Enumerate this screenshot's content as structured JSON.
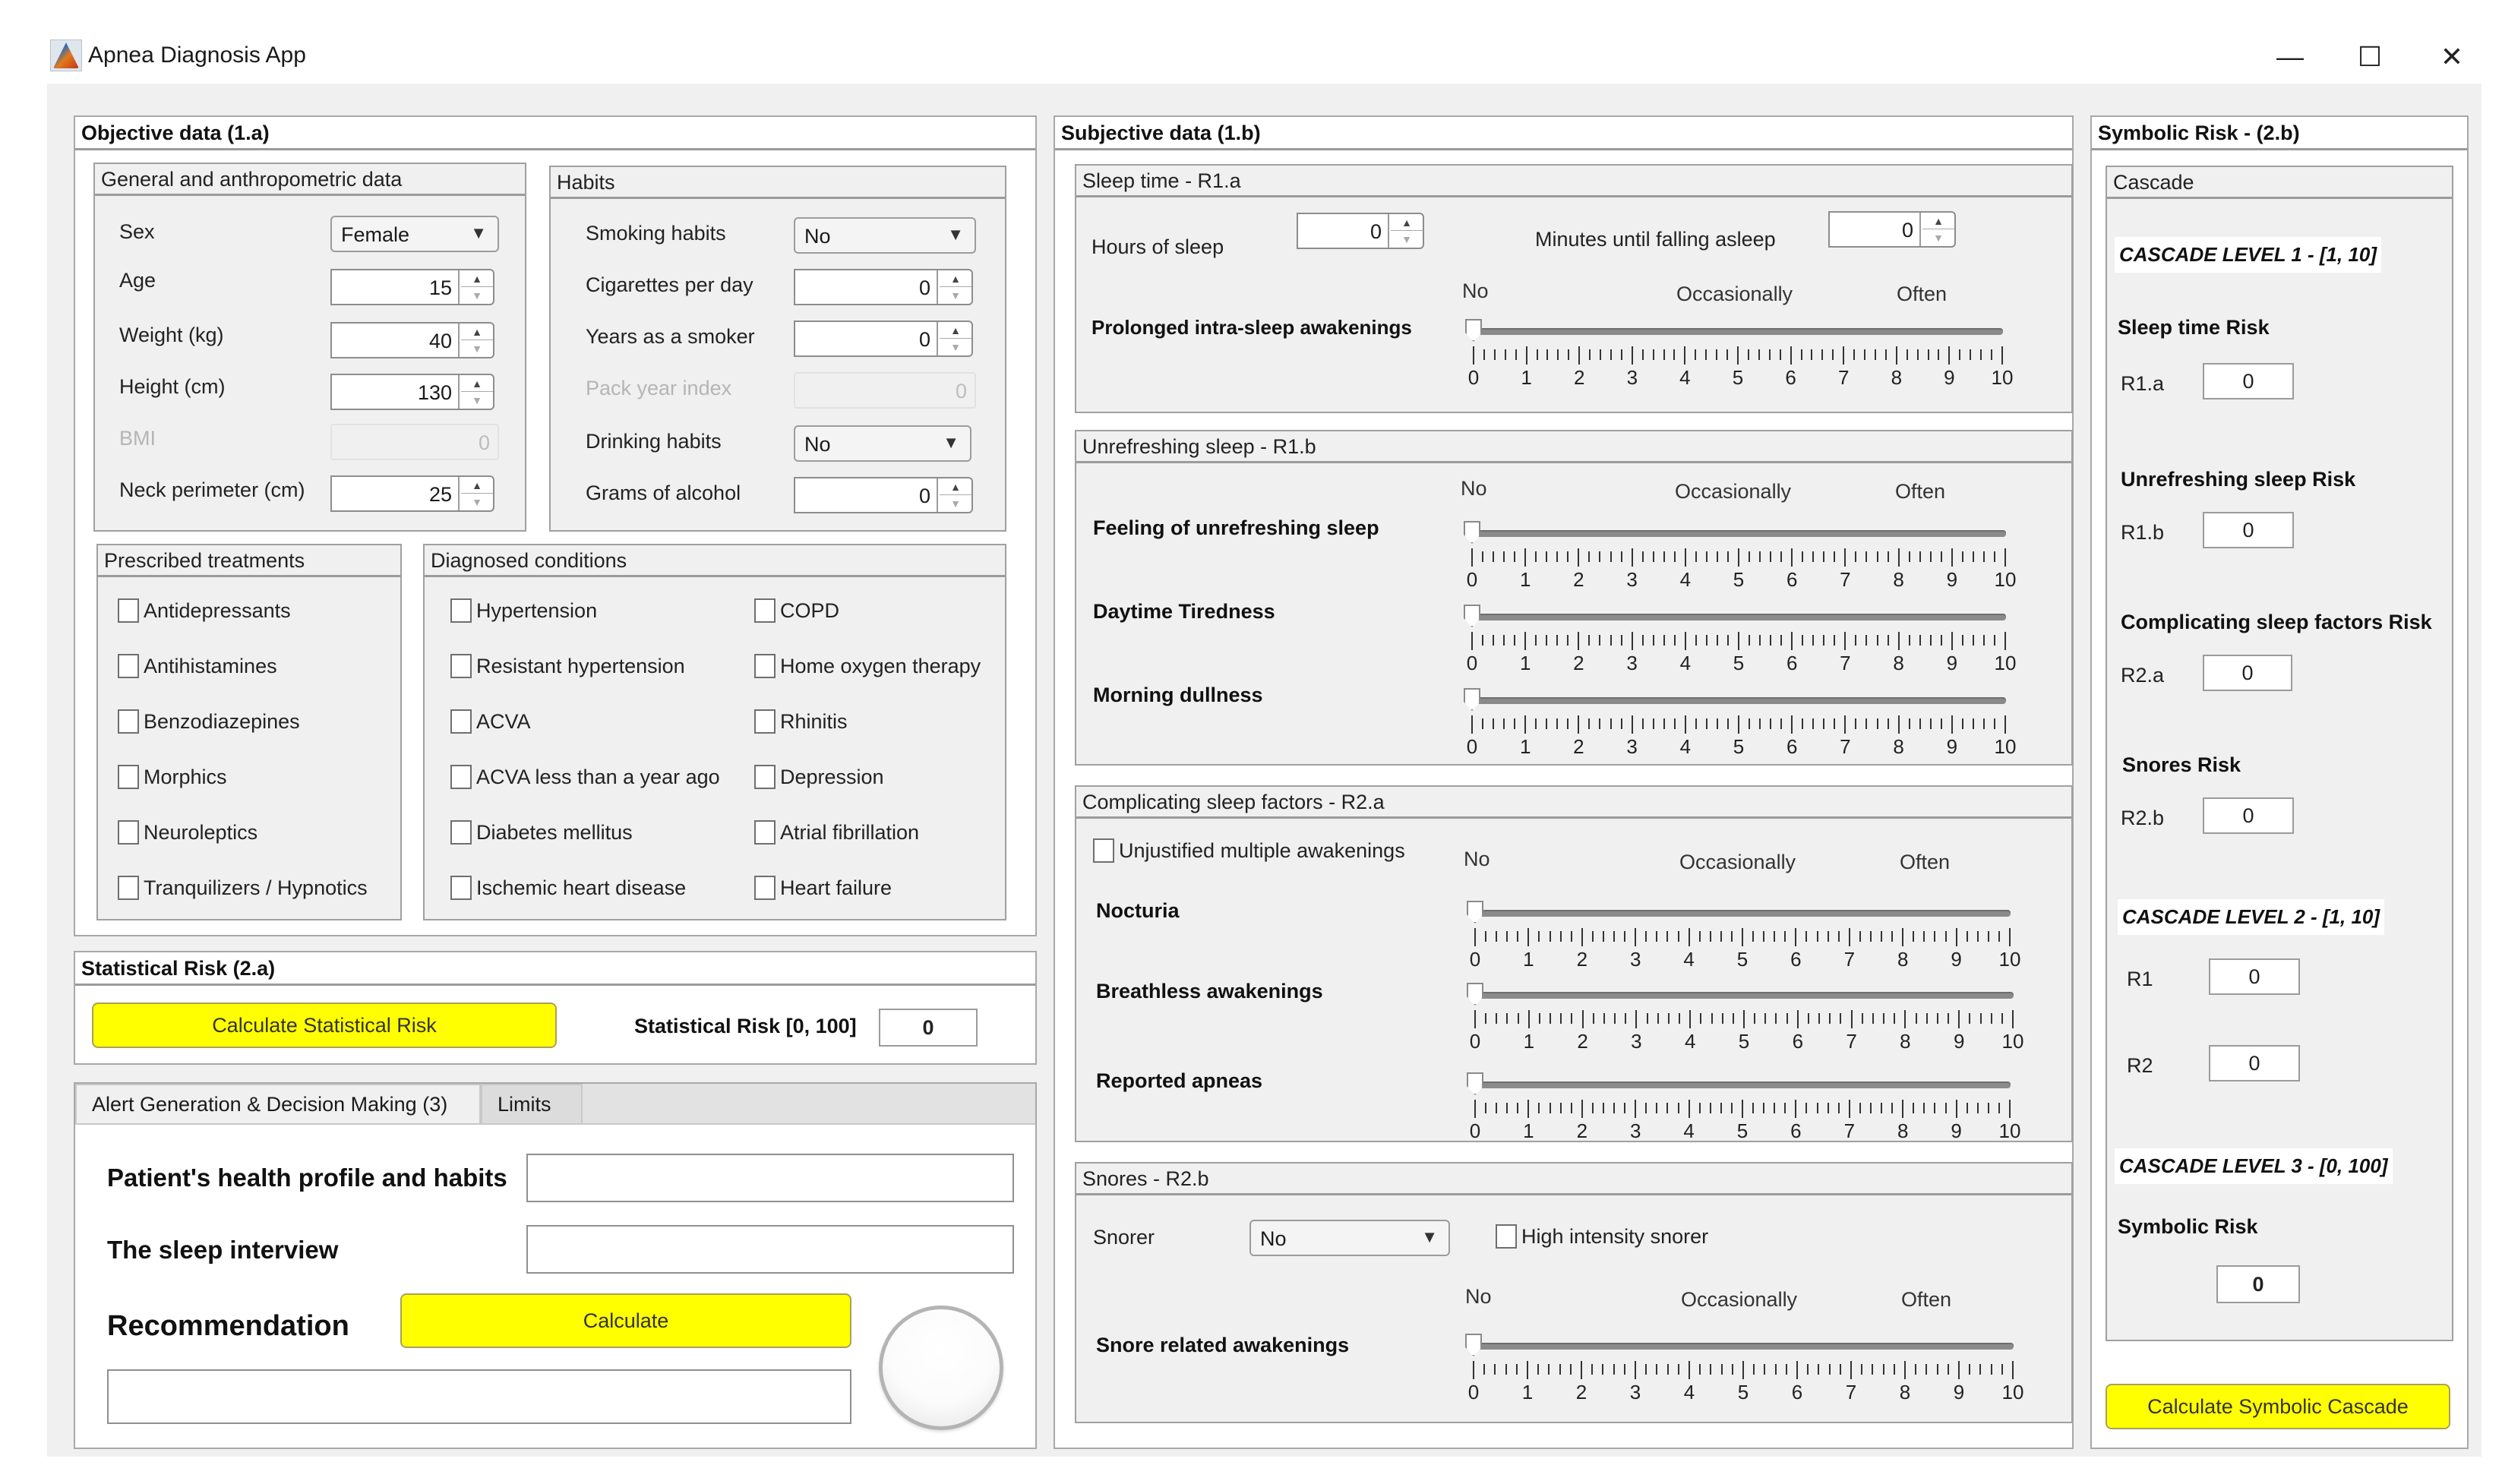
{
  "window": {
    "title": "Apnea Diagnosis App",
    "controls": {
      "minimize": "—",
      "maximize": "☐",
      "close": "✕"
    }
  },
  "objective": {
    "title": "Objective data (1.a)",
    "general": {
      "title": "General and anthropometric data",
      "sex_label": "Sex",
      "sex_value": "Female",
      "age_label": "Age",
      "age_value": "15",
      "weight_label": "Weight (kg)",
      "weight_value": "40",
      "height_label": "Height (cm)",
      "height_value": "130",
      "bmi_label": "BMI",
      "bmi_value": "0",
      "neck_label": "Neck perimeter (cm)",
      "neck_value": "25"
    },
    "habits": {
      "title": "Habits",
      "smoking_label": "Smoking habits",
      "smoking_value": "No",
      "cigarettes_label": "Cigarettes per day",
      "cigarettes_value": "0",
      "years_label": "Years as a smoker",
      "years_value": "0",
      "pack_label": "Pack year index",
      "pack_value": "0",
      "drinking_label": "Drinking habits",
      "drinking_value": "No",
      "alcohol_label": "Grams of alcohol",
      "alcohol_value": "0"
    },
    "treatments": {
      "title": "Prescribed treatments",
      "items": [
        "Antidepressants",
        "Antihistamines",
        "Benzodiazepines",
        "Morphics",
        "Neuroleptics",
        "Tranquilizers / Hypnotics"
      ]
    },
    "conditions": {
      "title": "Diagnosed conditions",
      "left": [
        "Hypertension",
        "Resistant hypertension",
        "ACVA",
        "ACVA less than a year ago",
        "Diabetes mellitus",
        "Ischemic heart disease"
      ],
      "right": [
        "COPD",
        "Home oxygen therapy",
        "Rhinitis",
        "Depression",
        "Atrial fibrillation",
        "Heart failure"
      ]
    }
  },
  "statistical": {
    "title": "Statistical Risk (2.a)",
    "button": "Calculate Statistical Risk",
    "result_label": "Statistical Risk [0, 100]",
    "result_value": "0"
  },
  "alerts": {
    "tabs": [
      "Alert Generation & Decision Making (3)",
      "Limits"
    ],
    "health_label": "Patient's health profile and habits",
    "health_value": "",
    "interview_label": "The sleep interview",
    "interview_value": "",
    "recommendation_label": "Recommendation",
    "calculate_button": "Calculate",
    "recommendation_value": "",
    "lamp_color": "#f2f2f2"
  },
  "subjective": {
    "title": "Subjective data (1.b)",
    "scale": {
      "no": "No",
      "occasionally": "Occasionally",
      "often": "Often",
      "min": 0,
      "max": 10,
      "ticks": [
        "0",
        "1",
        "2",
        "3",
        "4",
        "5",
        "6",
        "7",
        "8",
        "9",
        "10"
      ]
    },
    "sleep_time": {
      "title": "Sleep time - R1.a",
      "hours_label": "Hours of sleep",
      "hours_value": "0",
      "minutes_label": "Minutes until falling asleep",
      "minutes_value": "0",
      "sliders": [
        {
          "label": "Prolonged intra-sleep awakenings",
          "value": 0
        }
      ]
    },
    "unrefreshing": {
      "title": "Unrefreshing sleep - R1.b",
      "sliders": [
        {
          "label": "Feeling of unrefreshing sleep",
          "value": 0
        },
        {
          "label": "Daytime Tiredness",
          "value": 0
        },
        {
          "label": "Morning dullness",
          "value": 0
        }
      ]
    },
    "complicating": {
      "title": "Complicating sleep factors - R2.a",
      "checkbox": "Unjustified multiple awakenings",
      "sliders": [
        {
          "label": "Nocturia",
          "value": 0
        },
        {
          "label": "Breathless awakenings",
          "value": 0
        },
        {
          "label": "Reported apneas",
          "value": 0
        }
      ]
    },
    "snores": {
      "title": "Snores - R2.b",
      "snorer_label": "Snorer",
      "snorer_value": "No",
      "high_intensity": "High intensity snorer",
      "sliders": [
        {
          "label": "Snore related awakenings",
          "value": 0
        }
      ]
    }
  },
  "symbolic": {
    "title": "Symbolic Risk - (2.b)",
    "cascade_title": "Cascade",
    "level1": "CASCADE LEVEL 1 -  [1, 10]",
    "sleep_time_risk": "Sleep time Risk",
    "r1a_label": "R1.a",
    "r1a_value": "0",
    "unrefreshing_risk": "Unrefreshing sleep Risk",
    "r1b_label": "R1.b",
    "r1b_value": "0",
    "complicating_risk": "Complicating sleep factors Risk",
    "r2a_label": "R2.a",
    "r2a_value": "0",
    "snores_risk": "Snores Risk",
    "r2b_label": "R2.b",
    "r2b_value": "0",
    "level2": "CASCADE LEVEL 2 - [1, 10]",
    "r1_label": "R1",
    "r1_value": "0",
    "r2_label": "R2",
    "r2_value": "0",
    "level3": "CASCADE LEVEL 3 -  [0, 100]",
    "symbolic_risk_label": "Symbolic Risk",
    "symbolic_risk_value": "0",
    "button": "Calculate Symbolic Cascade"
  }
}
